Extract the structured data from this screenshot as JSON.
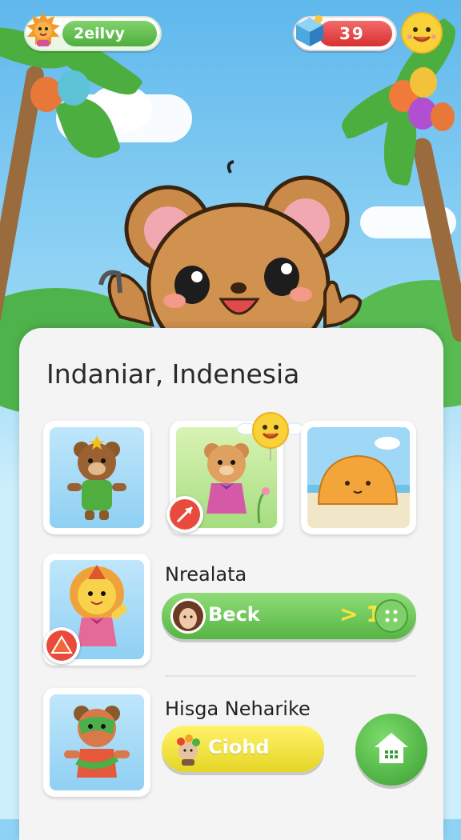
{
  "top_bar": {
    "player_name": "2eilvy",
    "gem_count": "39"
  },
  "card": {
    "title": "Indaniar, Indenesia"
  },
  "rows": [
    {
      "name": "Nrealata",
      "button_label": "Beck",
      "button_value": "> 1"
    },
    {
      "name": "Hisga Neharike",
      "button_label": "Ciohd"
    }
  ],
  "colors": {
    "green_button": "#56b544",
    "yellow_button": "#e6d525",
    "gem_pill": "#d93030",
    "home_button": "#3a9e33"
  }
}
